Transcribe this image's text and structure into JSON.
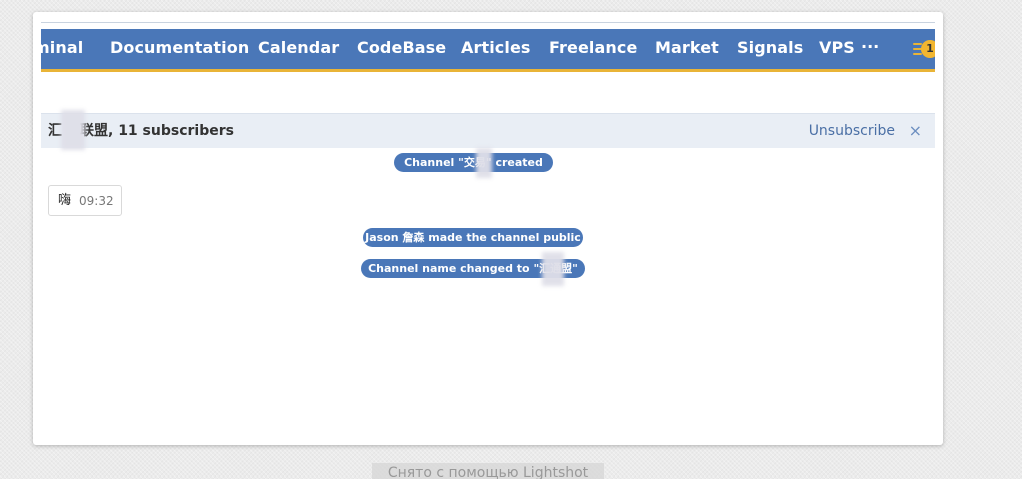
{
  "nav": {
    "items": [
      {
        "id": "terminal",
        "label": "minal"
      },
      {
        "id": "documentation",
        "label": "Documentation"
      },
      {
        "id": "calendar",
        "label": "Calendar"
      },
      {
        "id": "codebase",
        "label": "CodeBase"
      },
      {
        "id": "articles",
        "label": "Articles"
      },
      {
        "id": "freelance",
        "label": "Freelance"
      },
      {
        "id": "market",
        "label": "Market"
      },
      {
        "id": "signals",
        "label": "Signals"
      },
      {
        "id": "vps",
        "label": "VPS"
      }
    ],
    "more_label": "···",
    "notifications": {
      "icon": "list-notification-icon",
      "count": "1"
    }
  },
  "channel": {
    "title_prefix": "汇",
    "title_suffix": "联盟, 11 subscribers",
    "unsubscribe_label": "Unsubscribe",
    "close_symbol": "×"
  },
  "events": {
    "created": "Channel \"交易\" created",
    "made_public": "Jason 詹森 made the channel public",
    "renamed": "Channel name changed to \"汇通盟\""
  },
  "message": {
    "text": "嗨",
    "time": "09:32"
  },
  "footer": {
    "caption": "Снято с помощью Lightshot"
  },
  "colors": {
    "nav_bg": "#4a77b8",
    "nav_accent": "#e9b437",
    "header_bg": "#e9eef5",
    "link": "#4a6fa5",
    "pill_bg": "#4a77b8"
  }
}
